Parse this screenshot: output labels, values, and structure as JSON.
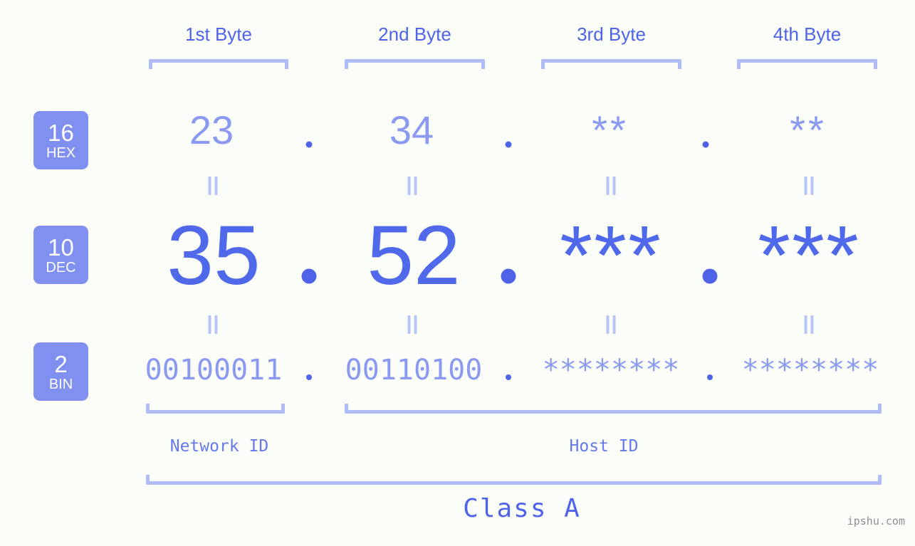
{
  "meta": {
    "background_color": "#fafdf8",
    "accent_dark": "#4f63e8",
    "accent_light": "#8b9af0",
    "bracket_color": "#b0bcf7",
    "badge_color": "#7f90f0"
  },
  "byte_headers": [
    {
      "label": "1st Byte"
    },
    {
      "label": "2nd Byte"
    },
    {
      "label": "3rd Byte"
    },
    {
      "label": "4th Byte"
    }
  ],
  "rows": [
    {
      "base_number": "16",
      "base_name": "HEX",
      "values": [
        "23",
        "34",
        "**",
        "**"
      ]
    },
    {
      "base_number": "10",
      "base_name": "DEC",
      "values": [
        "35",
        "52",
        "***",
        "***"
      ]
    },
    {
      "base_number": "2",
      "base_name": "BIN",
      "values": [
        "00100011",
        "00110100",
        "********",
        "********"
      ]
    }
  ],
  "separators": {
    "symbol": "."
  },
  "segments": [
    {
      "label": "Network ID"
    },
    {
      "label": "Host ID"
    }
  ],
  "class": {
    "label": "Class A"
  },
  "watermark": {
    "text": "ipshu.com"
  }
}
